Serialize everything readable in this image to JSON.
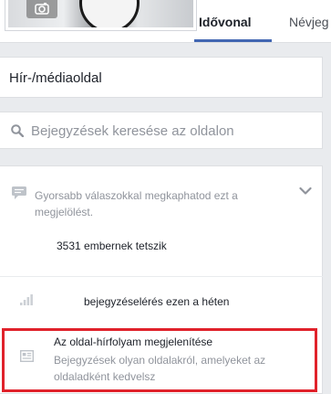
{
  "header": {
    "tabs": [
      {
        "label": "Idővonal",
        "active": true
      },
      {
        "label": "Névjeg",
        "active": false
      }
    ]
  },
  "page_category": "Hír-/médiaoldal",
  "search": {
    "placeholder": "Bejegyzések keresése az oldalon"
  },
  "info": {
    "response_message": "Gyorsabb válaszokkal megkaphatod ezt a megjelölést.",
    "likes": "3531 embernek tetszik",
    "reach": "bejegyzéselérés ezen a héten"
  },
  "feed_visibility": {
    "title": "Az oldal-hírfolyam megjelenítése",
    "description": "Bejegyzések olyan oldalakról, amelyeket az oldaladként kedvelsz"
  },
  "icons": {
    "camera": "camera-icon",
    "search": "search-icon",
    "speech": "speech-bubble-icon",
    "chevron": "chevron-down-icon",
    "reach": "signal-bars-icon",
    "feed": "news-feed-icon"
  },
  "colors": {
    "accent": "#4267b2",
    "highlight": "#e0222b",
    "muted_text": "#90949c",
    "background": "#e9ebee"
  }
}
